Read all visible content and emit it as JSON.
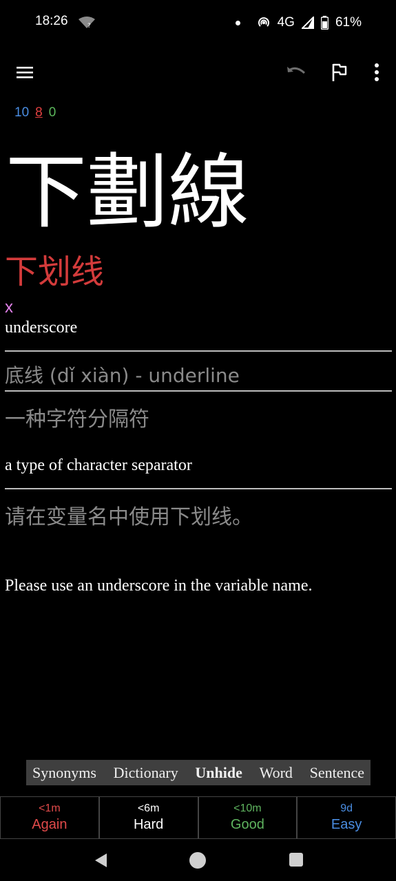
{
  "status_bar": {
    "time": "18:26",
    "network": "4G",
    "battery": "61%",
    "icons": [
      "wifi-question-icon",
      "dot-icon",
      "hotspot-icon",
      "signal-icon",
      "battery-icon"
    ]
  },
  "toolbar": {
    "icons": [
      "menu-icon",
      "undo-icon",
      "flag-icon",
      "more-vert-icon"
    ]
  },
  "counts": {
    "new": "10",
    "learning": "8",
    "review": "0",
    "colors": {
      "new": "#4a8de2",
      "learning": "#e04040",
      "review": "#5cb85c"
    }
  },
  "card": {
    "traditional": "下劃線",
    "simplified": "下划线",
    "pinyin": "x",
    "meaning": "underscore",
    "synonym": "底线 (dǐ xiàn) - underline",
    "definition_zh": "一种字符分隔符",
    "definition_en": "a type of character separator",
    "sentence_zh": "请在变量名中使用下划线。",
    "sentence_en": "Please use an underscore in the variable name."
  },
  "action_bar": {
    "synonyms": "Synonyms",
    "dictionary": "Dictionary",
    "unhide": "Unhide",
    "word": "Word",
    "sentence": "Sentence"
  },
  "answers": [
    {
      "time": "<1m",
      "label": "Again",
      "color": "#e04a4a"
    },
    {
      "time": "<6m",
      "label": "Hard",
      "color": "#ffffff"
    },
    {
      "time": "<10m",
      "label": "Good",
      "color": "#5fb45f"
    },
    {
      "time": "9d",
      "label": "Easy",
      "color": "#4a8de2"
    }
  ],
  "nav_bar": {
    "icons": [
      "back-icon",
      "home-icon",
      "recents-icon"
    ]
  }
}
